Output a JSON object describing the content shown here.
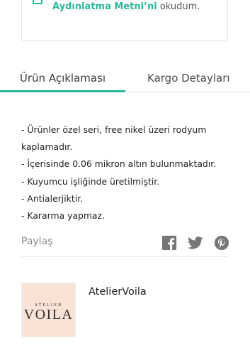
{
  "consent": {
    "link_text": "Aydınlatma Metni’ni",
    "suffix_text": " okudum."
  },
  "tabs": [
    {
      "label": "Ürün Açıklaması",
      "active": true
    },
    {
      "label": "Kargo Detayları",
      "active": false
    }
  ],
  "description": {
    "lines": [
      "- Ürünler özel seri, free nikel üzeri rodyum",
      "kaplamadır.",
      "- İçerisinde 0.06 mikron altın bulunmaktadır.",
      "- Kuyumcu işliğinde üretilmiştir.",
      "- Antialerjiktir.",
      "- Kararma yapmaz."
    ]
  },
  "share": {
    "label": "Paylaş",
    "icons": [
      "facebook-icon",
      "twitter-icon",
      "pinterest-icon"
    ]
  },
  "seller": {
    "name": "AtelierVoila",
    "logo_small": "ATELIER",
    "logo_big": "VOILA"
  },
  "colors": {
    "accent": "#2bb79c",
    "logo_bg": "#f9e3d6",
    "icon_gray": "#777777"
  }
}
